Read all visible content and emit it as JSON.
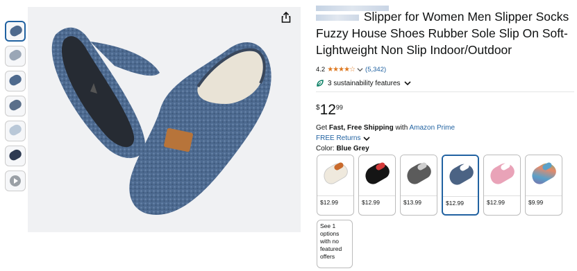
{
  "product": {
    "title": "Slipper for Women Men Slipper Socks Fuzzy House Shoes Rubber Sole Slip On Soft-Lightweight Non Slip Indoor/Outdoor",
    "rating": "4.2",
    "stars": "★★★★☆",
    "review_count": "(5,342)",
    "sustainability": "3 sustainability features",
    "price_symbol": "$",
    "price_whole": "12",
    "price_fraction": "99"
  },
  "shipping": {
    "prefix": "Get ",
    "bold": "Fast, Free Shipping",
    "mid": " with ",
    "prime": "Amazon Prime",
    "returns": "FREE Returns"
  },
  "color": {
    "label": "Color: ",
    "selected": "Blue Grey"
  },
  "swatches": [
    {
      "price": "$12.99",
      "color": "#efe9dd",
      "inner": "#c96a2c"
    },
    {
      "price": "$12.99",
      "color": "#151515",
      "inner": "#d43a3a"
    },
    {
      "price": "$13.99",
      "color": "#5b5b5b",
      "inner": "#cfcfcf"
    },
    {
      "price": "$12.99",
      "color": "#4b6384",
      "inner": "#ffffff"
    },
    {
      "price": "$12.99",
      "color": "#e9a3b8",
      "inner": "#ffffff"
    },
    {
      "price": "$9.99",
      "color": "#7f6aa6",
      "inner": "#5aa0c8"
    }
  ],
  "see_options": "See 1 options with no featured offers",
  "icons": {
    "share": "share-icon",
    "leaf": "leaf-icon",
    "chevron": "chevron-down-icon",
    "play": "play-icon"
  },
  "colors": {
    "link": "#2162a1",
    "star": "#de7921",
    "selected_border": "#2162a1"
  }
}
